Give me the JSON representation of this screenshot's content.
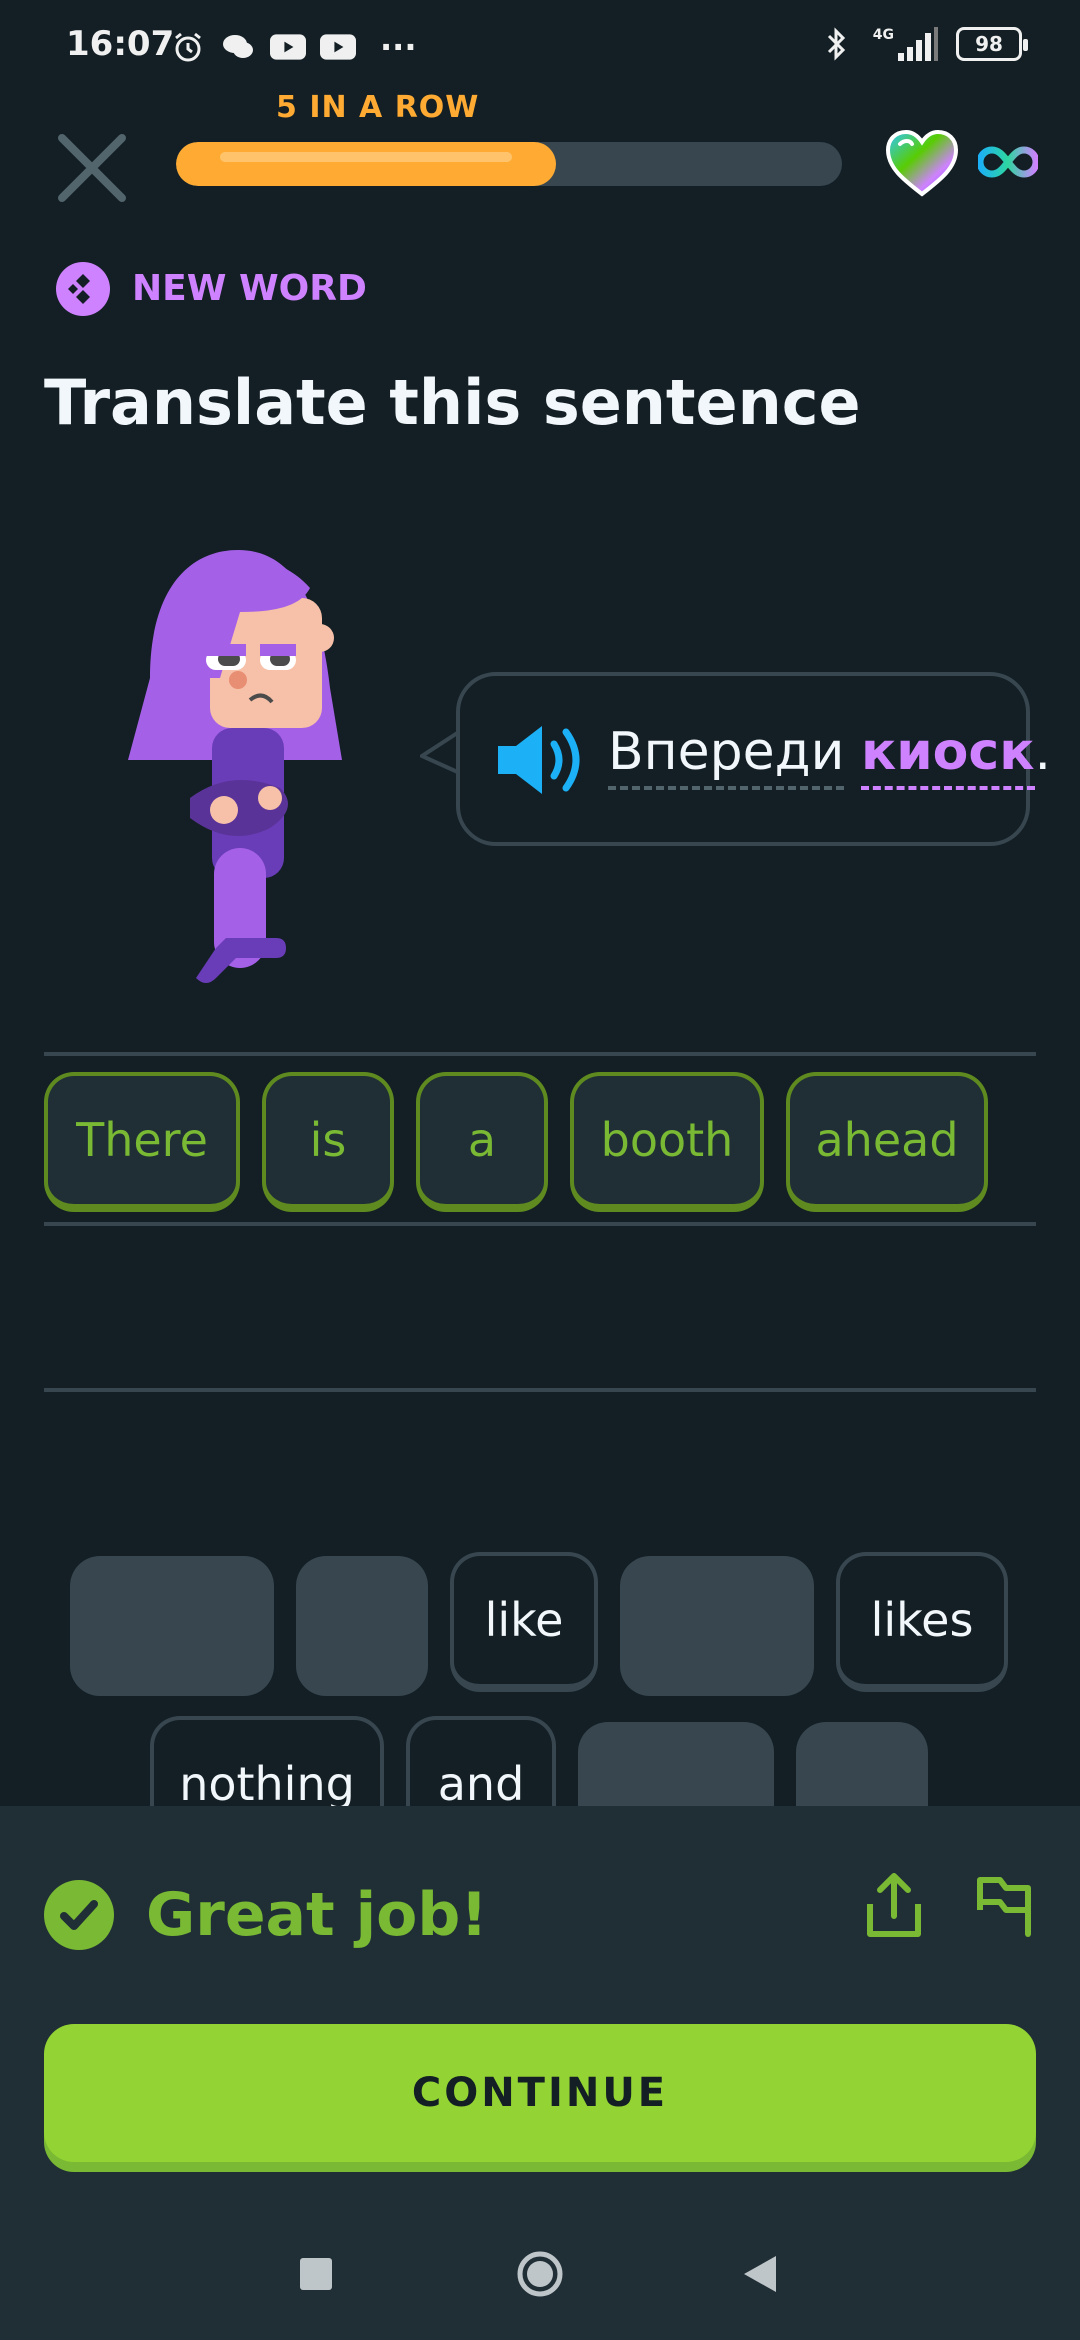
{
  "status_bar": {
    "time": "16:07",
    "network": "4G",
    "battery": "98",
    "more": "···"
  },
  "header": {
    "streak_label": "5 IN A ROW",
    "progress": 0.57,
    "hearts": "infinity"
  },
  "challenge": {
    "tag": "NEW WORD",
    "title": "Translate this sentence",
    "phrase_word1": "Впереди",
    "phrase_word2": "киоск",
    "phrase_punct": "."
  },
  "answer_words": [
    "There",
    "is",
    "a",
    "booth",
    "ahead"
  ],
  "word_bank": {
    "row1": [
      "",
      "",
      "like",
      "",
      "likes"
    ],
    "row2": [
      "nothing",
      "and",
      "",
      ""
    ]
  },
  "feedback": {
    "message": "Great job!",
    "continue_label": "CONTINUE"
  },
  "colors": {
    "background": "#131f24",
    "accent_green": "#93d333",
    "text_green": "#79b933",
    "streak_orange": "#ffab33",
    "purple": "#ce82ff",
    "speaker_blue": "#1cb0f6"
  }
}
